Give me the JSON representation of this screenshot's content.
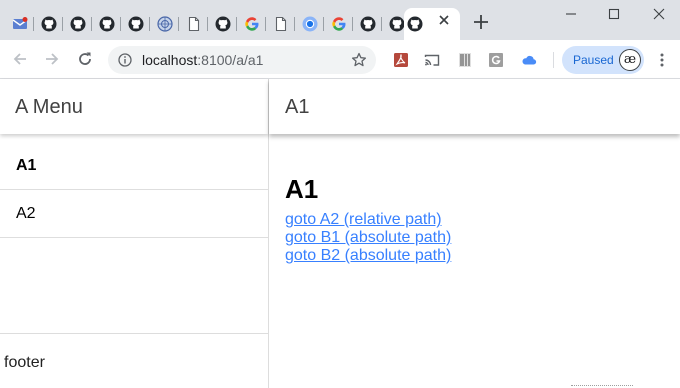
{
  "browser": {
    "tabs": [
      {
        "icon": "mail-icon",
        "active": false
      },
      {
        "icon": "github-icon",
        "active": false
      },
      {
        "icon": "github-icon",
        "active": false
      },
      {
        "icon": "github-icon",
        "active": false
      },
      {
        "icon": "github-icon",
        "active": false
      },
      {
        "icon": "globe-seal-icon",
        "active": false
      },
      {
        "icon": "document-icon",
        "active": false
      },
      {
        "icon": "github-icon",
        "active": false
      },
      {
        "icon": "google-icon",
        "active": false
      },
      {
        "icon": "document-icon",
        "active": false
      },
      {
        "icon": "chromium-icon",
        "active": false
      },
      {
        "icon": "google-icon",
        "active": false
      },
      {
        "icon": "github-icon",
        "active": false
      },
      {
        "icon": "github-icon",
        "active": false
      },
      {
        "icon": "github-icon",
        "active": true
      }
    ],
    "url_host": "localhost",
    "url_rest": ":8100/a/a1",
    "profile_label": "Paused",
    "profile_avatar": "æ",
    "accent": "#1a73e8"
  },
  "sidebar": {
    "title": "A Menu",
    "items": [
      {
        "label": "A1",
        "active": true
      },
      {
        "label": "A2",
        "active": false
      }
    ],
    "footer": "footer"
  },
  "main": {
    "header_title": "A1",
    "heading": "A1",
    "links": [
      {
        "label": "goto A2 (relative path)"
      },
      {
        "label": "goto B1 (absolute path)"
      },
      {
        "label": "goto B2 (absolute path)"
      }
    ],
    "link_color": "#3880ff"
  }
}
